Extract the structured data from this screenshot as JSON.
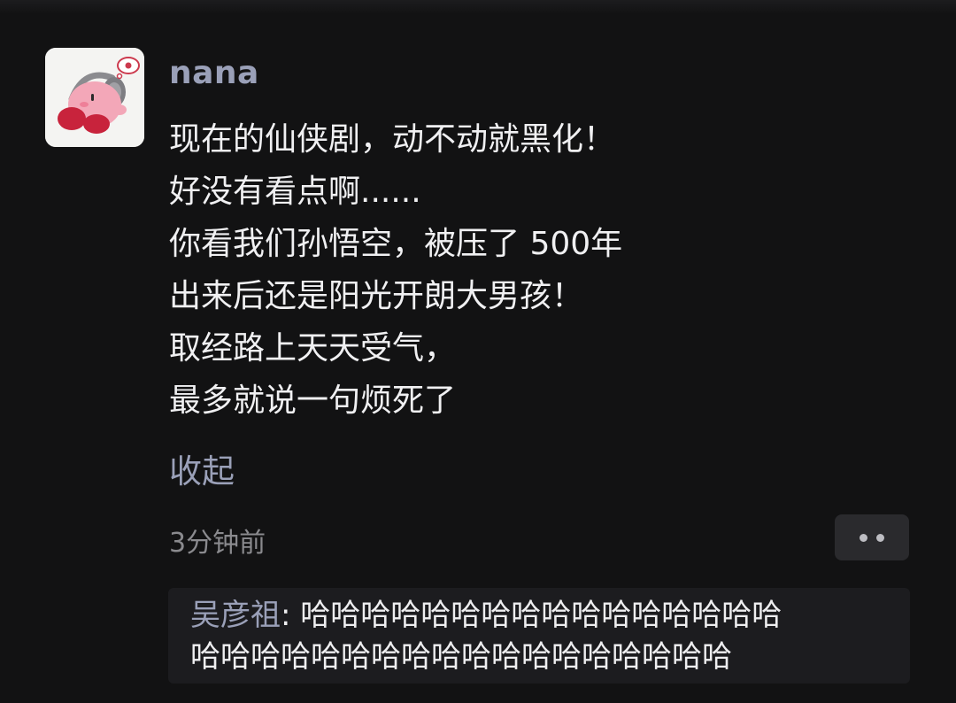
{
  "comment": {
    "avatar_icon": "kirby-avatar-icon",
    "username": "nana",
    "content_lines": [
      "现在的仙侠剧，动不动就黑化！",
      "好没有看点啊......",
      "你看我们孙悟空，被压了 500年",
      "出来后还是阳光开朗大男孩！",
      "取经路上天天受气，",
      "最多就说一句烦死了"
    ],
    "collapse_label": "收起",
    "timestamp": "3分钟前",
    "more_icon": "more-dots-icon"
  },
  "reply": {
    "author": "吴彦祖",
    "separator": ": ",
    "text_line_1": "哈哈哈哈哈哈哈哈哈哈哈哈哈哈哈哈",
    "text_line_2": "哈哈哈哈哈哈哈哈哈哈哈哈哈哈哈哈哈哈"
  },
  "colors": {
    "background": "#121213",
    "username": "#9aa0b8",
    "text": "#f0f0f2",
    "timestamp": "#8a8a8e",
    "reply_box": "#1c1c1f"
  }
}
